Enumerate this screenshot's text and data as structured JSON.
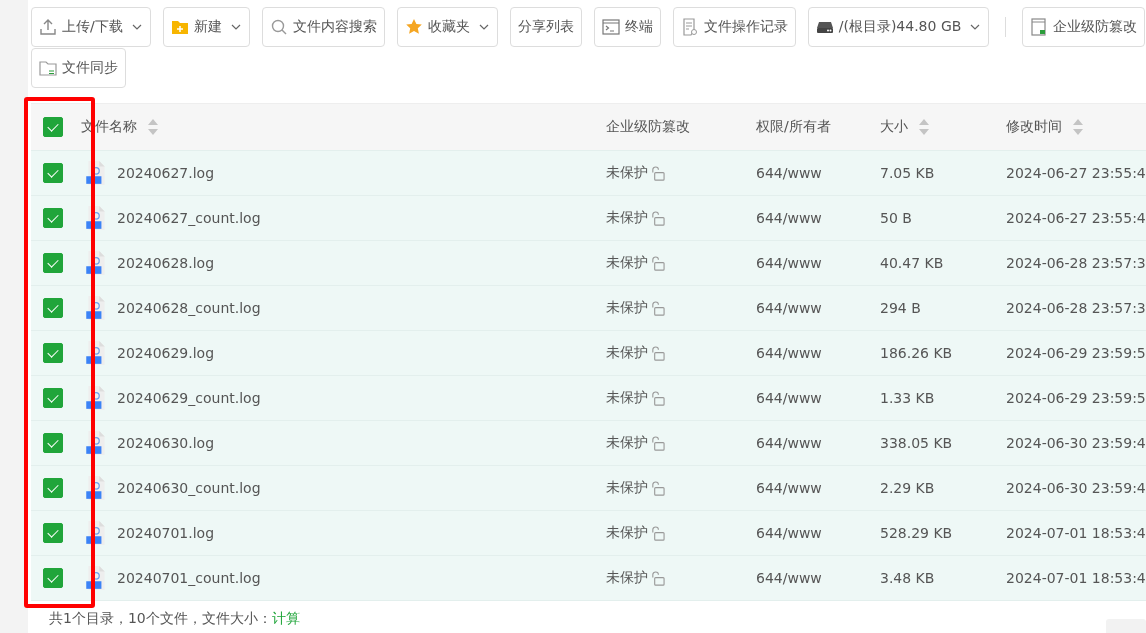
{
  "toolbar": [
    {
      "label": "上传/下载",
      "dropdown": true
    },
    {
      "label": "新建",
      "dropdown": true
    },
    {
      "label": "文件内容搜索",
      "dropdown": false
    },
    {
      "label": "收藏夹",
      "dropdown": true
    },
    {
      "label": "分享列表",
      "dropdown": false
    },
    {
      "label": "终端",
      "dropdown": false
    },
    {
      "label": "文件操作记录",
      "dropdown": false
    },
    {
      "label": "/(根目录)44.80 GB",
      "dropdown": true
    },
    {
      "label": "企业级防篡改",
      "dropdown": false,
      "separated": true
    },
    {
      "label": "文件同步",
      "dropdown": false,
      "wrapped": true
    }
  ],
  "table": {
    "select_all": {
      "checked": true
    },
    "columns": [
      {
        "label": "文件名称",
        "sortable": true
      },
      {
        "label": "企业级防篡改",
        "sortable": false
      },
      {
        "label": "权限/所有者",
        "sortable": false
      },
      {
        "label": "大小",
        "sortable": true
      },
      {
        "label": "修改时间",
        "sortable": true
      }
    ],
    "rows": [
      {
        "checked": true,
        "name": "20240627.log",
        "protection": "未保护",
        "permission": "644/www",
        "size": "7.05 KB",
        "modified": "2024-06-27 23:55:4"
      },
      {
        "checked": true,
        "name": "20240627_count.log",
        "protection": "未保护",
        "permission": "644/www",
        "size": "50 B",
        "modified": "2024-06-27 23:55:4"
      },
      {
        "checked": true,
        "name": "20240628.log",
        "protection": "未保护",
        "permission": "644/www",
        "size": "40.47 KB",
        "modified": "2024-06-28 23:57:3"
      },
      {
        "checked": true,
        "name": "20240628_count.log",
        "protection": "未保护",
        "permission": "644/www",
        "size": "294 B",
        "modified": "2024-06-28 23:57:3"
      },
      {
        "checked": true,
        "name": "20240629.log",
        "protection": "未保护",
        "permission": "644/www",
        "size": "186.26 KB",
        "modified": "2024-06-29 23:59:5"
      },
      {
        "checked": true,
        "name": "20240629_count.log",
        "protection": "未保护",
        "permission": "644/www",
        "size": "1.33 KB",
        "modified": "2024-06-29 23:59:5"
      },
      {
        "checked": true,
        "name": "20240630.log",
        "protection": "未保护",
        "permission": "644/www",
        "size": "338.05 KB",
        "modified": "2024-06-30 23:59:4"
      },
      {
        "checked": true,
        "name": "20240630_count.log",
        "protection": "未保护",
        "permission": "644/www",
        "size": "2.29 KB",
        "modified": "2024-06-30 23:59:4"
      },
      {
        "checked": true,
        "name": "20240701.log",
        "protection": "未保护",
        "permission": "644/www",
        "size": "528.29 KB",
        "modified": "2024-07-01 18:53:4"
      },
      {
        "checked": true,
        "name": "20240701_count.log",
        "protection": "未保护",
        "permission": "644/www",
        "size": "3.48 KB",
        "modified": "2024-07-01 18:53:4"
      }
    ]
  },
  "footer": {
    "summary": "共1个目录，10个文件，文件大小：",
    "link": "计算"
  },
  "highlight": {
    "shown": true
  }
}
